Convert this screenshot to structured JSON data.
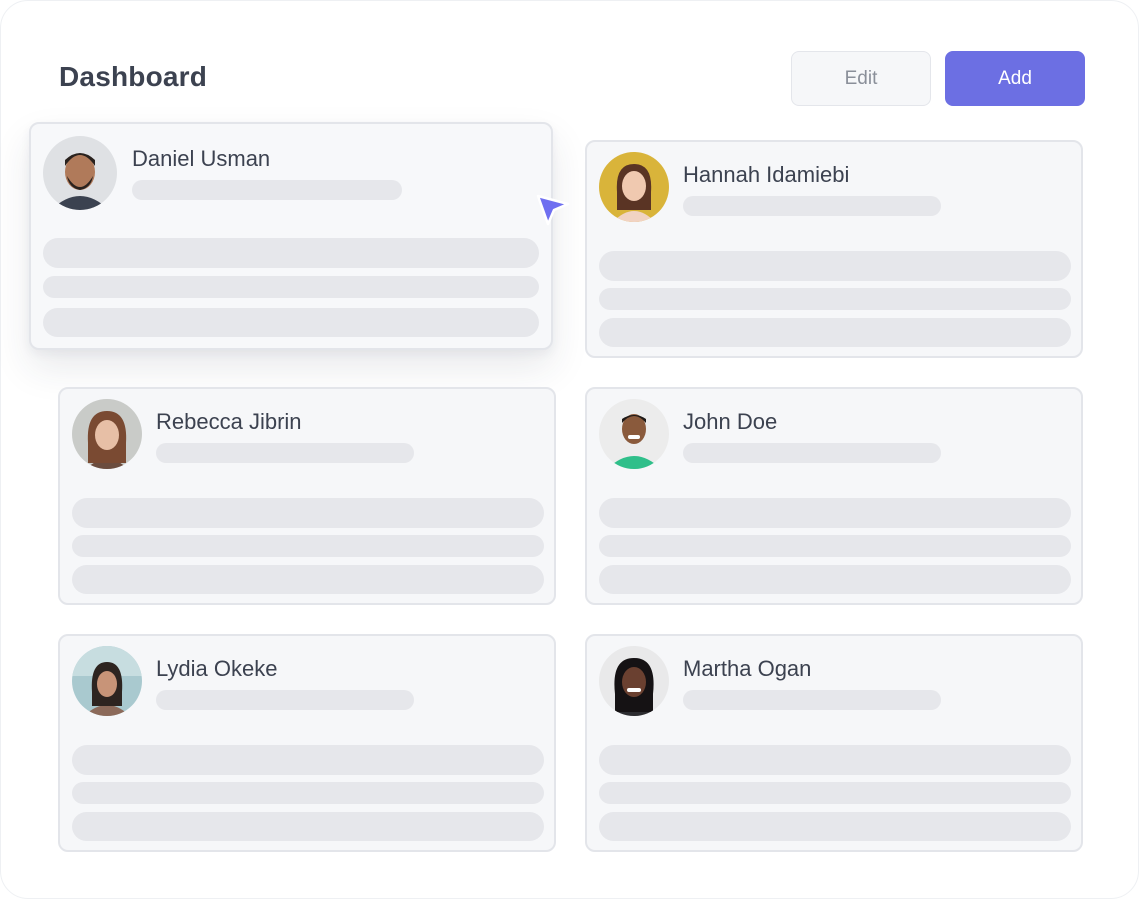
{
  "header": {
    "title": "Dashboard",
    "edit_label": "Edit",
    "add_label": "Add"
  },
  "cards": [
    {
      "name": "Daniel Usman"
    },
    {
      "name": "Hannah Idamiebi"
    },
    {
      "name": "Rebecca Jibrin"
    },
    {
      "name": "John Doe"
    },
    {
      "name": "Lydia Okeke"
    },
    {
      "name": "Martha Ogan"
    }
  ],
  "colors": {
    "accent": "#6c6fe3",
    "card_bg": "#f6f7f9",
    "skeleton": "#e6e7eb",
    "text": "#3c4250"
  }
}
